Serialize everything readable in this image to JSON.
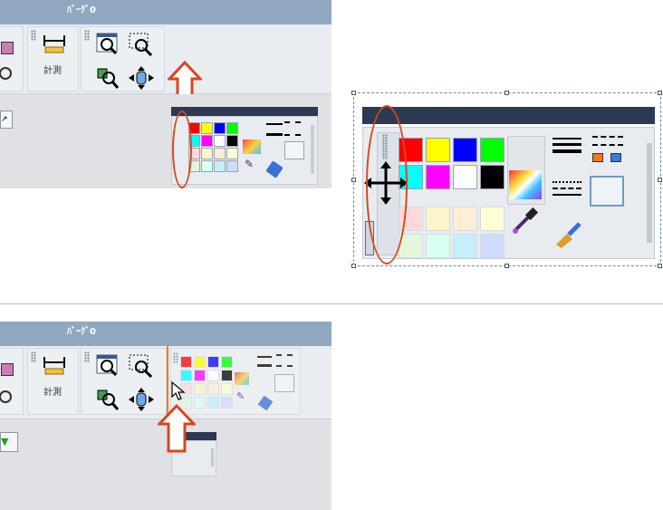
{
  "top_window": {
    "title": "ﾊﾞｰｸﾞ0",
    "measure_label": "計測"
  },
  "bottom_window": {
    "title": "ﾊﾞｰｸﾞ0",
    "measure_label": "計測"
  },
  "palette": {
    "colors_row1": [
      "#ff0000",
      "#ffff00",
      "#0000ff",
      "#00ff00"
    ],
    "colors_row2": [
      "#00ffff",
      "#ff00ff",
      "#ffffff",
      "#000000"
    ],
    "pastel_row1": [
      "#ffd9d9",
      "#fff5cc",
      "#ffeed6",
      "#ffffd5"
    ],
    "pastel_row2": [
      "#e3f7dd",
      "#d9fff0",
      "#c8eefa",
      "#cfdcff"
    ]
  },
  "annotation_color": "#d8461f",
  "selection_color": "#5e8db5",
  "icons": [
    "zoom-window-icon",
    "zoom-region-icon",
    "zoom-3d-icon",
    "pan-icon",
    "measure-icon",
    "eyedropper-icon",
    "paint-brush-icon",
    "gradient-icon",
    "line-weight-icon",
    "line-type-icon",
    "move-cursor-icon",
    "arrow-up-icon"
  ]
}
